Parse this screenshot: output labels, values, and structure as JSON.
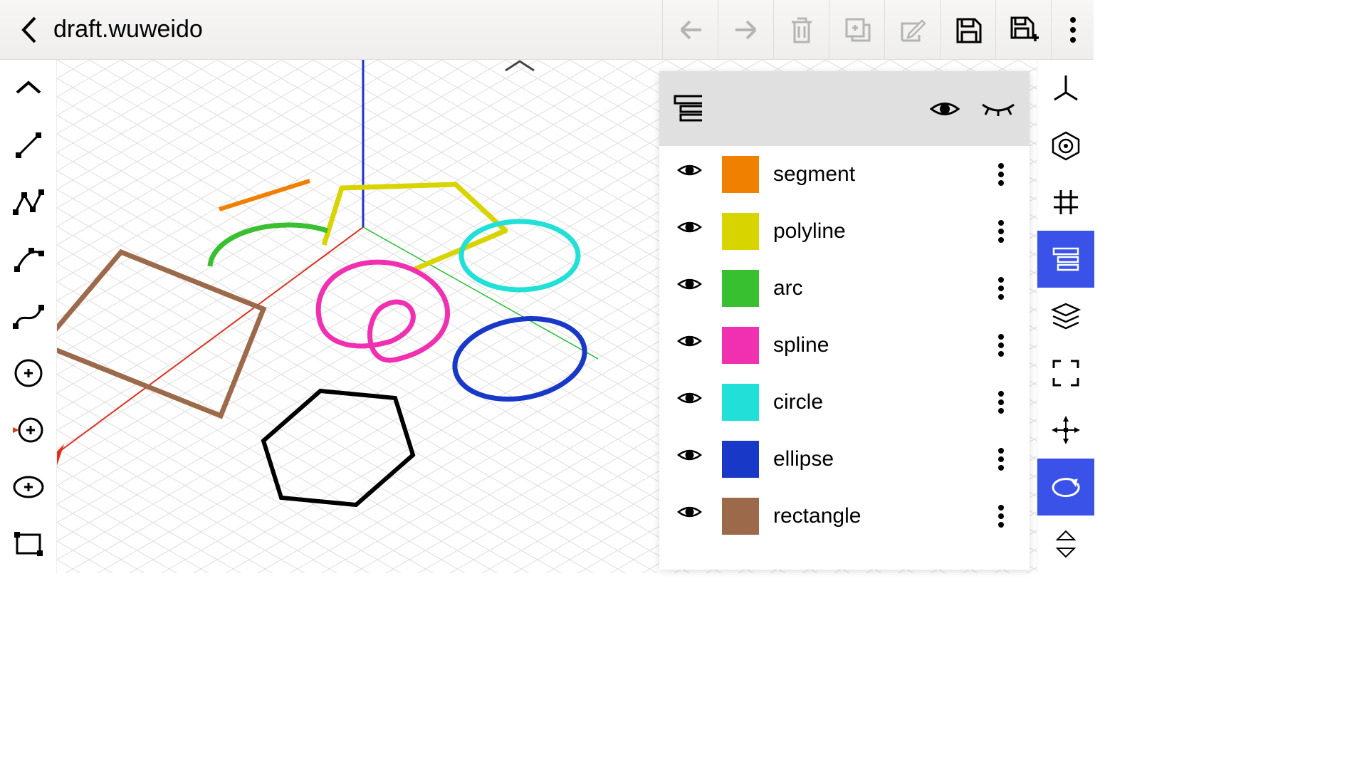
{
  "header": {
    "filename": "draft.wuweido"
  },
  "layers": [
    {
      "name": "segment",
      "color": "#f08000"
    },
    {
      "name": "polyline",
      "color": "#d8d400"
    },
    {
      "name": "arc",
      "color": "#38c030"
    },
    {
      "name": "spline",
      "color": "#f030b0"
    },
    {
      "name": "circle",
      "color": "#20e0d8"
    },
    {
      "name": "ellipse",
      "color": "#1838c8"
    },
    {
      "name": "rectangle",
      "color": "#9c6a4a"
    }
  ]
}
